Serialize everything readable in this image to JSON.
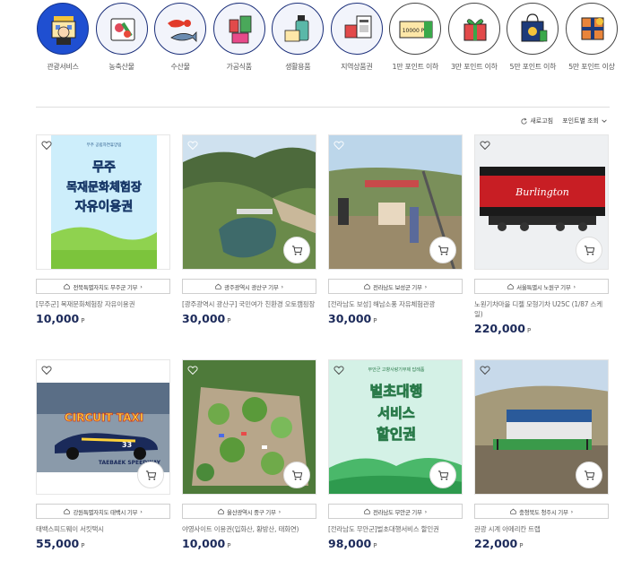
{
  "categories": [
    {
      "label": "관광서비스",
      "icon": "tourism-service-icon"
    },
    {
      "label": "농축산물",
      "icon": "agricultural-products-icon"
    },
    {
      "label": "수산물",
      "icon": "seafood-icon"
    },
    {
      "label": "가공식품",
      "icon": "processed-food-icon"
    },
    {
      "label": "생활용품",
      "icon": "household-goods-icon"
    },
    {
      "label": "지역상품권",
      "icon": "local-gift-voucher-icon"
    },
    {
      "label": "1만 포인트 이하",
      "icon": "voucher-10000p-icon",
      "voucher_text": "10000 P"
    },
    {
      "label": "3만 포인트 이하",
      "icon": "gift-box-icon"
    },
    {
      "label": "5만 포인트 이하",
      "icon": "shopping-bag-icon"
    },
    {
      "label": "5만 포인트 이상",
      "icon": "gift-package-icon"
    }
  ],
  "toolbar": {
    "refresh": "새로고침",
    "sort": "포인트별 조회"
  },
  "products": [
    {
      "region": "전북특별자치도 무주군 기부",
      "name": "[무주군] 목재문화체험장 자유이용권",
      "price": "10,000",
      "unit": "P",
      "poster": {
        "small": "무주 공립자연휴양림",
        "line1": "무주",
        "line2": "목재문화체험장",
        "line3": "자유이용권"
      }
    },
    {
      "region": "광주광역시 광산구 기부",
      "name": "[광주광역시 광산구] 국민여가 친환경 오토캠핑장",
      "price": "30,000",
      "unit": "P"
    },
    {
      "region": "전라남도 보성군 기부",
      "name": "[전라남도 보성] 해남소풍 자유체험관광",
      "price": "30,000",
      "unit": "P"
    },
    {
      "region": "서울특별시 노원구 기부",
      "name": "노원기차마을 디젤 모형기차 U25C (1/87 스케일)",
      "price": "220,000",
      "unit": "P",
      "train_text": "Burlington"
    },
    {
      "region": "강원특별자치도 태백시 기부",
      "name": "태백스피드웨이 서킷택시",
      "price": "55,000",
      "unit": "P",
      "circuit_title": "CIRCUIT TAXI",
      "circuit_sub": "TAEBAEK SPEEDWAY",
      "car_number": "33"
    },
    {
      "region": "울산광역시 중구 기부",
      "name": "야영사이트 이용권(입화산, 황방산, 태화연)",
      "price": "10,000",
      "unit": "P"
    },
    {
      "region": "전라남도 무안군 기부",
      "name": "[전라남도 무안군]벌초대행서비스 할인권",
      "price": "98,000",
      "unit": "P",
      "poster": {
        "small": "무안군 고향사랑기부제 답례품",
        "line1": "벌초대행",
        "line2": "서비스",
        "line3": "할인권"
      }
    },
    {
      "region": "충청북도 청주시 기부",
      "name": "관광 시계 아메리칸 트랩",
      "price": "22,000",
      "unit": "P"
    }
  ]
}
